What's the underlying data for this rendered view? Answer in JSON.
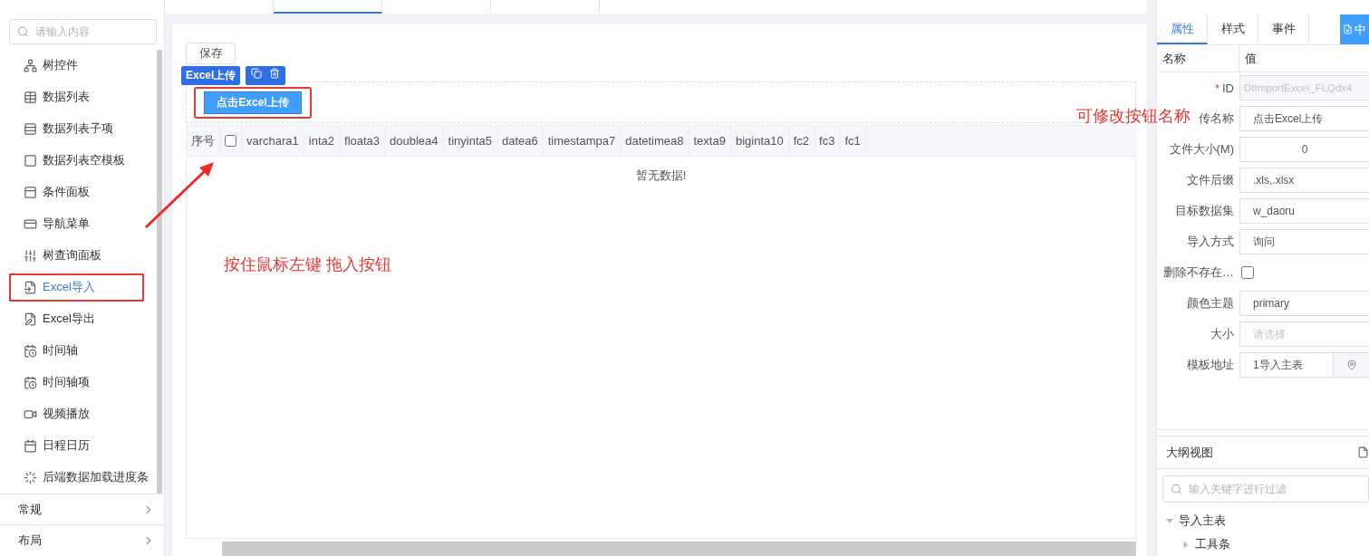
{
  "toolbox": {
    "search": {
      "placeholder": "请输入内容"
    },
    "items": [
      {
        "label": "树控件",
        "selected": false
      },
      {
        "label": "数据列表",
        "selected": false
      },
      {
        "label": "数据列表子项",
        "selected": false
      },
      {
        "label": "数据列表空模板",
        "selected": false
      },
      {
        "label": "条件面板",
        "selected": false
      },
      {
        "label": "导航菜单",
        "selected": false
      },
      {
        "label": "树查询面板",
        "selected": false
      },
      {
        "label": "Excel导入",
        "selected": true
      },
      {
        "label": "Excel导出",
        "selected": false
      },
      {
        "label": "时间轴",
        "selected": false
      },
      {
        "label": "时间轴项",
        "selected": false
      },
      {
        "label": "视频播放",
        "selected": false
      },
      {
        "label": "日程日历",
        "selected": false
      },
      {
        "label": "后端数据加载进度条",
        "selected": false
      }
    ],
    "groups": [
      {
        "label": "常规",
        "expanded": false
      },
      {
        "label": "布局",
        "expanded": false
      }
    ]
  },
  "editor_tabs": [
    {
      "selected": false
    },
    {
      "selected": true
    },
    {
      "selected": false
    },
    {
      "selected": false
    }
  ],
  "canvas": {
    "save_button": "保存",
    "component_tag": "Excel上传",
    "upload_button": "点击Excel上传",
    "table": {
      "columns": [
        {
          "kind": "text",
          "label": "序号"
        },
        {
          "kind": "checkbox",
          "checked": false
        },
        {
          "kind": "text",
          "label": "varchara1"
        },
        {
          "kind": "text",
          "label": "inta2"
        },
        {
          "kind": "text",
          "label": "floata3"
        },
        {
          "kind": "text",
          "label": "doublea4"
        },
        {
          "kind": "text",
          "label": "tinyinta5"
        },
        {
          "kind": "text",
          "label": "datea6"
        },
        {
          "kind": "text",
          "label": "timestampa7"
        },
        {
          "kind": "text",
          "label": "datetimea8"
        },
        {
          "kind": "text",
          "label": "texta9"
        },
        {
          "kind": "text",
          "label": "biginta10"
        },
        {
          "kind": "text",
          "label": "fc2"
        },
        {
          "kind": "text",
          "label": "fc3"
        },
        {
          "kind": "text",
          "label": "fc1"
        }
      ],
      "empty_text": "暂无数据!"
    }
  },
  "annotations": [
    "按住鼠标左键 拖入按钮",
    "可修改按钮名称"
  ],
  "properties": {
    "tabs": [
      {
        "label": "属性",
        "selected": true
      },
      {
        "label": "样式",
        "selected": false
      },
      {
        "label": "事件",
        "selected": false
      }
    ],
    "action_button": "中",
    "header": [
      "名称",
      "值"
    ],
    "rows": [
      {
        "kind": "disabled",
        "label": "ID",
        "required_mark": "*",
        "value": "DtImportExcel_FLQdx4"
      },
      {
        "kind": "input",
        "label": "传名称",
        "value": "点击Excel上传"
      },
      {
        "kind": "number",
        "label": "文件大小(M)",
        "value": "0"
      },
      {
        "kind": "input",
        "label": "文件后缀",
        "value": ".xls,.xlsx"
      },
      {
        "kind": "input",
        "label": "目标数据集",
        "value": "w_daoru"
      },
      {
        "kind": "input",
        "label": "导入方式",
        "value": "询问"
      },
      {
        "kind": "checkbox",
        "label": "删除不存在…",
        "checked": false
      },
      {
        "kind": "input",
        "label": "颜色主题",
        "value": "primary"
      },
      {
        "kind": "select",
        "label": "大小",
        "placeholder": "请选择"
      },
      {
        "kind": "picker",
        "label": "模板地址",
        "value": "1导入主表"
      }
    ]
  },
  "outline": {
    "title": "大纲视图",
    "search": {
      "placeholder": "输入关键字进行过滤"
    },
    "tree": [
      {
        "label": "导入主表",
        "expanded": true,
        "children": [
          {
            "label": "工具条",
            "expanded": false
          }
        ]
      }
    ]
  }
}
